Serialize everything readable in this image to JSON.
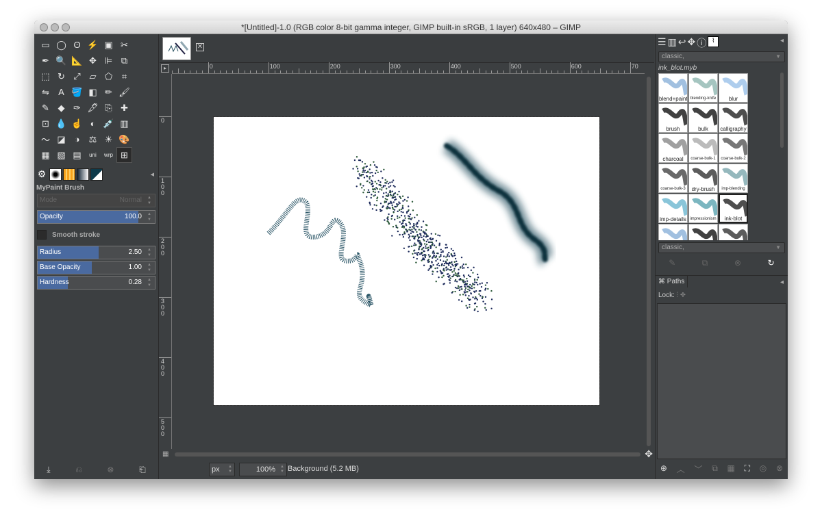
{
  "window": {
    "title": "*[Untitled]-1.0 (RGB color 8-bit gamma integer, GIMP built-in sRGB, 1 layer) 640x480 – GIMP"
  },
  "toolbox": {
    "tools": [
      "rect-select",
      "ellipse-select",
      "free-select",
      "fuzzy-select",
      "select-by-color",
      "scissors",
      "paths",
      "zoom",
      "measure",
      "move",
      "align",
      "crop",
      "unified-transform",
      "rotate",
      "scale",
      "shear",
      "perspective",
      "cage",
      "flip",
      "text",
      "bucket-fill",
      "blend",
      "pencil",
      "paintbrush",
      "eraser",
      "airbrush",
      "ink",
      "mypaint-brush",
      "clone",
      "heal",
      "perspective-clone",
      "blur",
      "smudge",
      "dodge-burn",
      "color-picker",
      "levels",
      "curves",
      "threshold",
      "hue",
      "color-balance",
      "brightness",
      "hue-sat",
      "desaturate",
      "posterize",
      "mypaint-active",
      "warp",
      "gegl",
      "threshold2"
    ],
    "tool_glyphs": [
      "▭",
      "◯",
      "ʘ",
      "⚡",
      "▣",
      "✂",
      "✒",
      "🔍",
      "📐",
      "✥",
      "⊫",
      "⧉",
      "⬚",
      "↻",
      "⤢",
      "▱",
      "⬠",
      "⌗",
      "⇋",
      "A",
      "🪣",
      "◧",
      "✏",
      "🖌",
      "✎",
      "◆",
      "✑",
      "🖋",
      "⎘",
      "✚",
      "⊡",
      "💧",
      "☝",
      "◐",
      "💉",
      "▥",
      "〜",
      "◪",
      "◑",
      "⚖",
      "☀",
      "🎨",
      "▦",
      "▧",
      "▤",
      "uni",
      "wrp",
      "⊞"
    ],
    "panel_tabs": [
      "tool-options",
      "brushes",
      "gradients",
      "patterns",
      "colors"
    ],
    "tool_options": {
      "title": "MyPaint Brush",
      "mode_label": "Mode",
      "mode_value": "Normal",
      "opacity_label": "Opacity",
      "opacity_value": "100.0",
      "opacity_fraction": 1.0,
      "smooth_stroke_label": "Smooth stroke",
      "smooth_stroke_checked": false,
      "radius_label": "Radius",
      "radius_value": "2.50",
      "radius_fraction": 0.52,
      "base_opacity_label": "Base Opacity",
      "base_opacity_value": "1.00",
      "base_opacity_fraction": 0.46,
      "hardness_label": "Hardness",
      "hardness_value": "0.28",
      "hardness_fraction": 0.26
    }
  },
  "canvas": {
    "hruler_labels": [
      "0",
      "100",
      "200",
      "300",
      "400",
      "500",
      "600",
      "70"
    ],
    "vruler_labels": [
      "0",
      "100",
      "200",
      "300",
      "400",
      "500"
    ],
    "zoom_unit": "px",
    "zoom_value": "100%",
    "layer_status": "Background (5.2 MB)"
  },
  "right_panel": {
    "preset_filter": "classic,",
    "selected_brush": "ink_blot.myb",
    "brushes": [
      "blend+paint",
      "blending-knife",
      "blur",
      "brush",
      "bulk",
      "calligraphy",
      "charcoal",
      "coarse-bulk-1",
      "coarse-bulk-2",
      "coarse-bulk-3",
      "dry-brush",
      "imp-blending",
      "imp-details",
      "impressionism",
      "ink-blot",
      "",
      "",
      ""
    ],
    "tag_filter": "classic,",
    "paths_tab": "Paths",
    "lock_label": "Lock:"
  },
  "colors": {
    "selection": "#4a6aa0",
    "bg": "#3c3f41",
    "ink": "#1f4a5a"
  }
}
